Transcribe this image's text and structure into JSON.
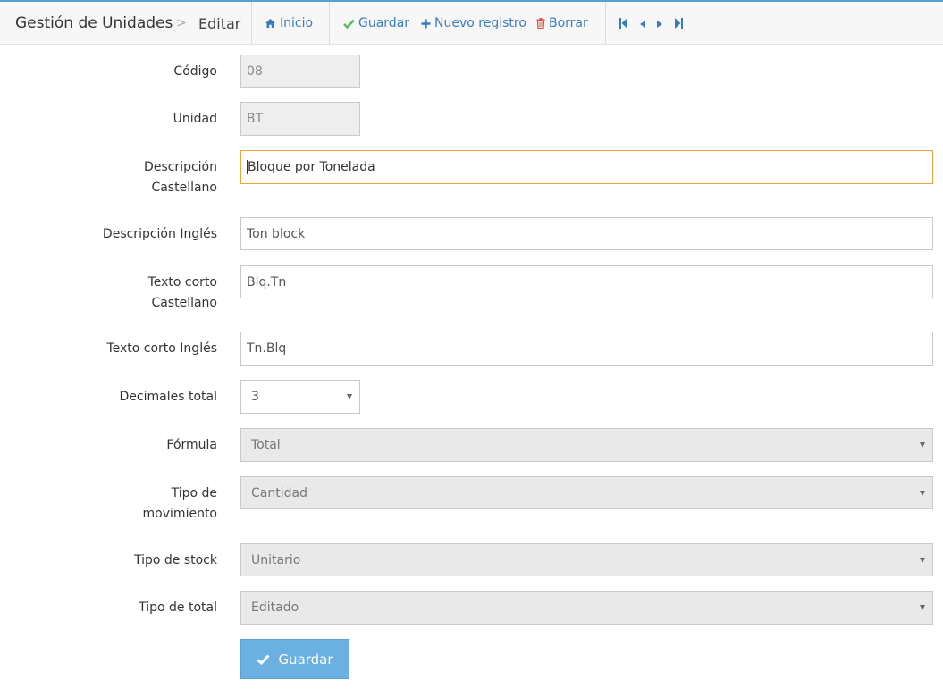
{
  "header": {
    "title": "Gestión de Unidades",
    "separator": ">",
    "crumb": "Editar",
    "home_label": "Inicio",
    "save_label": "Guardar",
    "new_label": "Nuevo registro",
    "delete_label": "Borrar"
  },
  "form": {
    "codigo": {
      "label": "Código",
      "value": "08"
    },
    "unidad": {
      "label": "Unidad",
      "value": "BT"
    },
    "desc_es": {
      "label_1": "Descripción",
      "label_2": "Castellano",
      "value": "Bloque por Tonelada"
    },
    "desc_en": {
      "label": "Descripción Inglés",
      "value": "Ton block"
    },
    "short_es": {
      "label_1": "Texto corto",
      "label_2": "Castellano",
      "value": "Blq.Tn"
    },
    "short_en": {
      "label": "Texto corto Inglés",
      "value": "Tn.Blq"
    },
    "decimales": {
      "label": "Decimales total",
      "value": "3"
    },
    "formula": {
      "label": "Fórmula",
      "value": "Total"
    },
    "tipo_mov": {
      "label_1": "Tipo de",
      "label_2": "movimiento",
      "value": "Cantidad"
    },
    "tipo_stock": {
      "label": "Tipo de stock",
      "value": "Unitario"
    },
    "tipo_total": {
      "label": "Tipo de total",
      "value": "Editado"
    },
    "submit_label": "Guardar"
  },
  "colors": {
    "accent": "#3a7bbf",
    "success": "#5cb85c",
    "danger": "#d9534f",
    "focus_border": "#e8a63c",
    "button": "#6ab0e0"
  },
  "icons": [
    "home-icon",
    "check-icon",
    "plus-icon",
    "trash-icon",
    "first-icon",
    "prev-icon",
    "next-icon",
    "last-icon",
    "check-icon"
  ]
}
